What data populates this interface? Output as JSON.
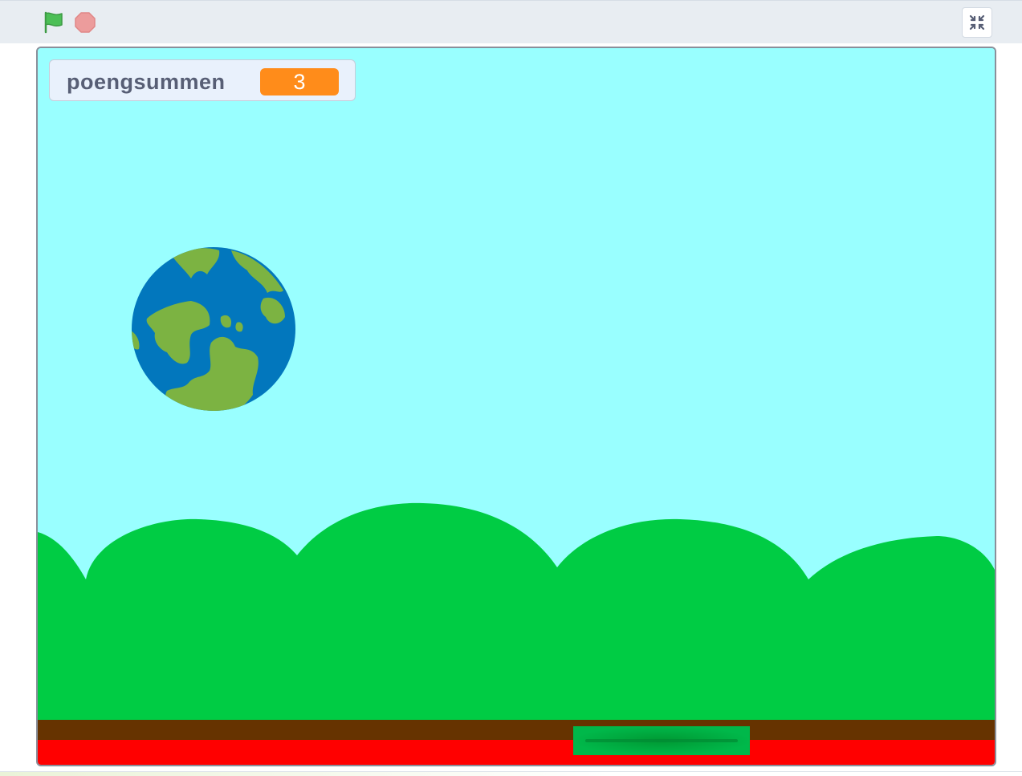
{
  "toolbar": {
    "green_flag": "green-flag-icon",
    "stop": "stop-sign-icon",
    "unfullscreen": "exit-fullscreen-icon"
  },
  "stage": {
    "background_color": "#99ffff",
    "hills_color": "#00cc44",
    "dirt_color": "#663300",
    "lava_color": "#ff0000"
  },
  "monitor": {
    "label": "poengsummen",
    "value": "3",
    "value_color": "#ff8c1a"
  },
  "sprites": {
    "earth": "earth-icon",
    "paddle": "paddle"
  },
  "colors": {
    "flag": "#4cbf56",
    "stop": "#ec9c9c",
    "earth_ocean": "#0277bd",
    "earth_land": "#7cb342",
    "paddle": "#00b84a"
  }
}
